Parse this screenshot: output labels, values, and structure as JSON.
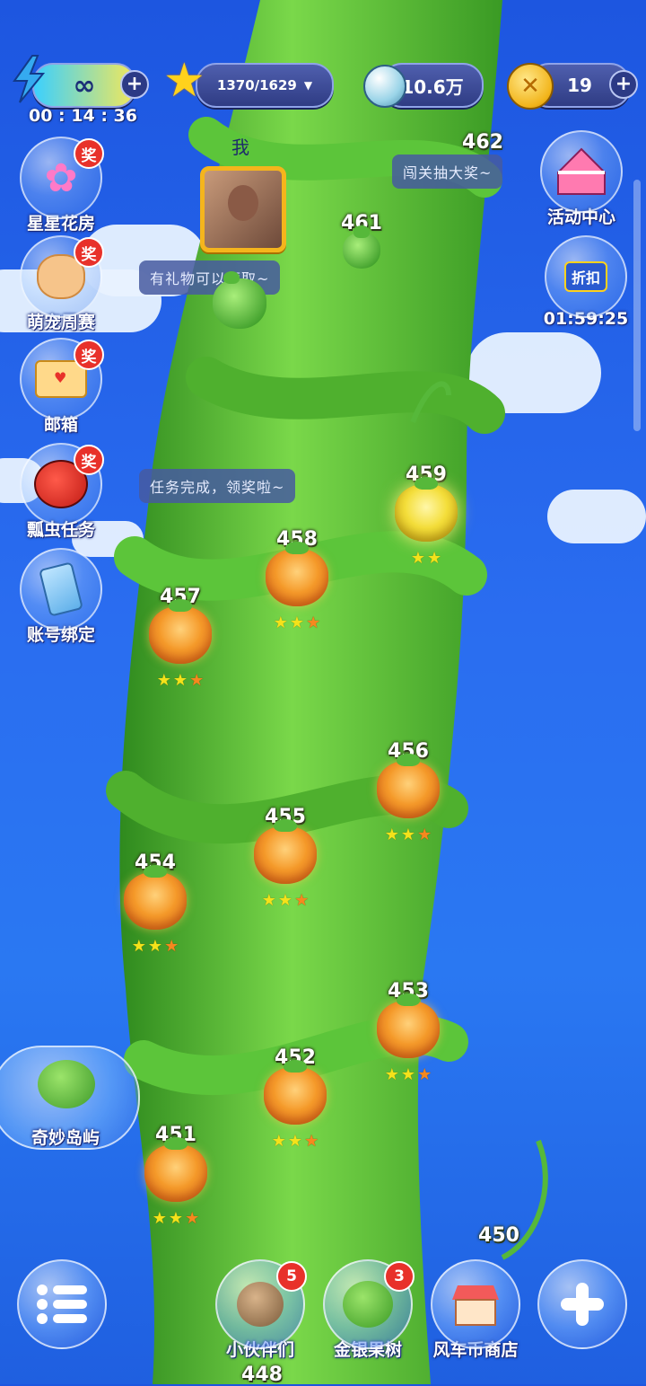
{
  "hud": {
    "energy": {
      "value": "∞",
      "timer": "00 : 14 : 36"
    },
    "stars": {
      "value": "1370/1629"
    },
    "coins": {
      "value": "10.6万"
    },
    "tokens": {
      "value": "19"
    }
  },
  "player": {
    "label": "我"
  },
  "speech": {
    "gift": "有礼物可以领取~",
    "task": "任务完成，领奖啦~",
    "lottery": "闯关抽大奖~"
  },
  "left_menu": [
    {
      "label": "星星花房",
      "badge": "奖"
    },
    {
      "label": "萌宠周赛",
      "badge": "奖"
    },
    {
      "label": "邮箱",
      "badge": "奖"
    },
    {
      "label": "瓢虫任务",
      "badge": "奖"
    },
    {
      "label": "账号绑定",
      "badge": ""
    }
  ],
  "right_menu": [
    {
      "label": "活动中心"
    },
    {
      "label": "01:59:25",
      "icon_text": "折扣"
    }
  ],
  "island": {
    "label": "奇妙岛屿"
  },
  "levels": [
    {
      "num": "462"
    },
    {
      "num": "461"
    },
    {
      "num": "459",
      "stars": 2
    },
    {
      "num": "458",
      "stars": 3
    },
    {
      "num": "457",
      "stars": 3
    },
    {
      "num": "456",
      "stars": 3
    },
    {
      "num": "455",
      "stars": 3
    },
    {
      "num": "454",
      "stars": 3
    },
    {
      "num": "453",
      "stars": 3
    },
    {
      "num": "452",
      "stars": 3
    },
    {
      "num": "451",
      "stars": 3
    },
    {
      "num": "450"
    },
    {
      "num": "448"
    }
  ],
  "bottom_bar": [
    {
      "label": "",
      "icon": "menu-icon"
    },
    {
      "label": "小伙伴们",
      "badge": "5"
    },
    {
      "label": "金银果树",
      "badge": "3"
    },
    {
      "label": "风车币商店",
      "badge": ""
    },
    {
      "label": "",
      "icon": "plus-icon"
    }
  ],
  "colors": {
    "sky": "#2a6df0",
    "vine": "#5cc53a",
    "badge_red": "#e8312a"
  }
}
